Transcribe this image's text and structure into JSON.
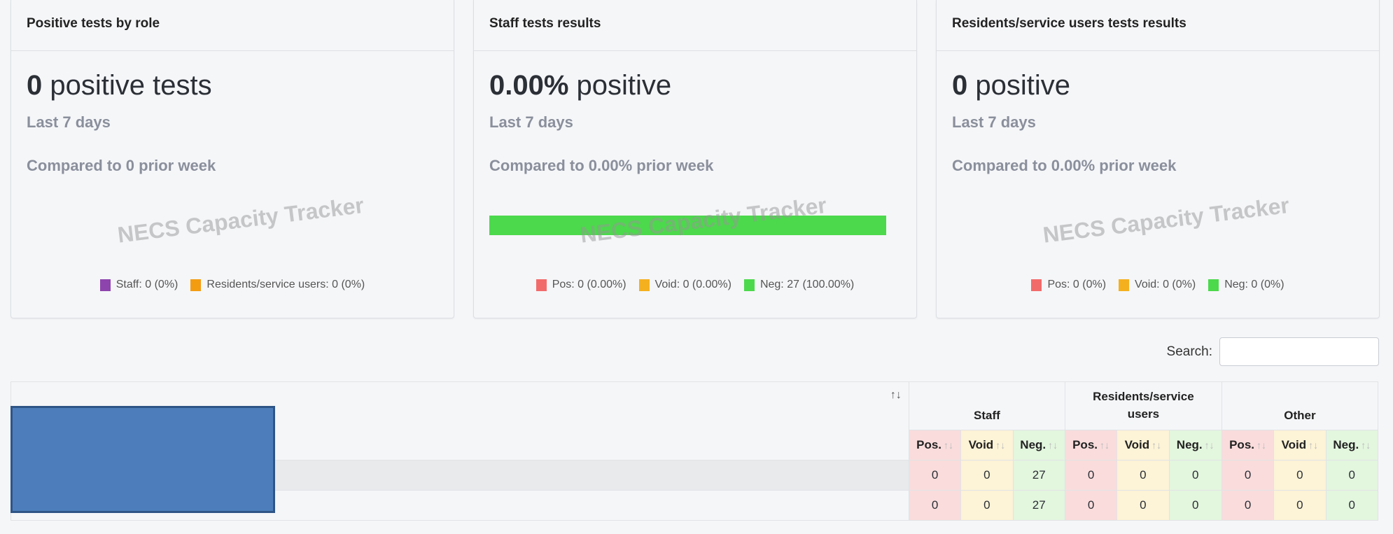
{
  "cards": [
    {
      "title": "Positive tests by role",
      "value": "0",
      "value_suffix": " positive tests",
      "period": "Last 7 days",
      "comparison": "Compared to 0 prior week",
      "watermark": "NECS Capacity Tracker",
      "legend": [
        {
          "label": "Staff: 0 (0%)",
          "color": "#8e44ad"
        },
        {
          "label": "Residents/service users: 0 (0%)",
          "color": "#f39c12"
        }
      ]
    },
    {
      "title": "Staff tests results",
      "value": "0.00%",
      "value_suffix": " positive",
      "period": "Last 7 days",
      "comparison": "Compared to 0.00% prior week",
      "watermark": "NECS Capacity Tracker",
      "bar": {
        "negative_fraction": 1.0,
        "color": "#4cd94c"
      },
      "legend": [
        {
          "label": "Pos: 0 (0.00%)",
          "color": "#f26b6b"
        },
        {
          "label": "Void: 0 (0.00%)",
          "color": "#f5b020"
        },
        {
          "label": "Neg: 27 (100.00%)",
          "color": "#4cd94c"
        }
      ]
    },
    {
      "title": "Residents/service users tests results",
      "value": "0",
      "value_suffix": " positive",
      "period": "Last 7 days",
      "comparison": "Compared to 0.00% prior week",
      "watermark": "NECS Capacity Tracker",
      "legend": [
        {
          "label": "Pos: 0 (0%)",
          "color": "#f26b6b"
        },
        {
          "label": "Void: 0 (0%)",
          "color": "#f5b020"
        },
        {
          "label": "Neg: 0 (0%)",
          "color": "#4cd94c"
        }
      ]
    }
  ],
  "search": {
    "label": "Search:",
    "value": ""
  },
  "table": {
    "sort_glyph": "↑↓",
    "groups": [
      "Staff",
      "Residents/service users",
      "Other"
    ],
    "subheaders": [
      "Pos.",
      "Void",
      "Neg.",
      "Pos.",
      "Void",
      "Neg.",
      "Pos.",
      "Void",
      "Neg."
    ],
    "rows": [
      [
        "0",
        "0",
        "27",
        "0",
        "0",
        "0",
        "0",
        "0",
        "0"
      ],
      [
        "0",
        "0",
        "27",
        "0",
        "0",
        "0",
        "0",
        "0",
        "0"
      ]
    ]
  }
}
